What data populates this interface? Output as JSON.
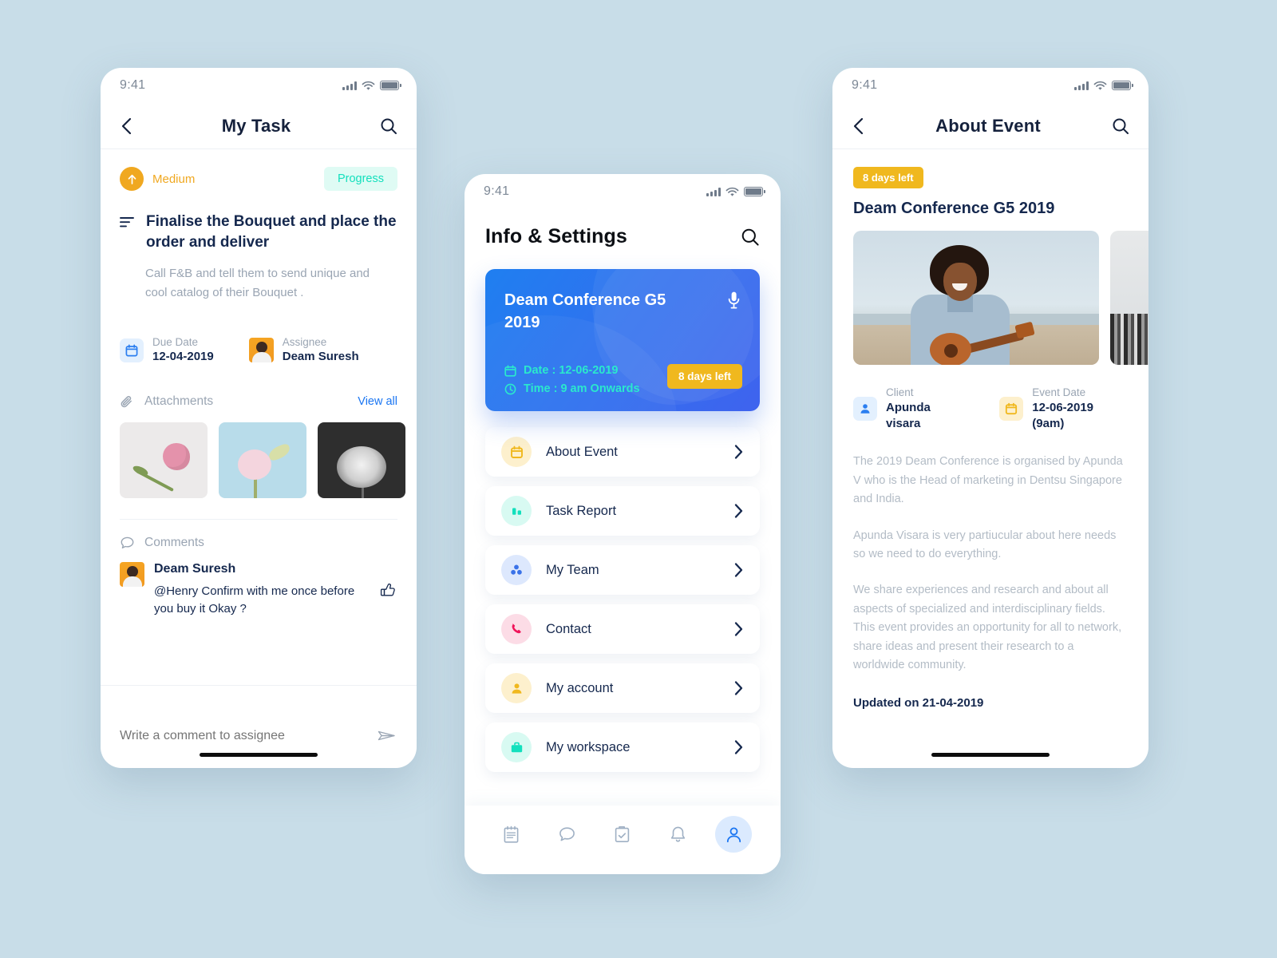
{
  "statusbar": {
    "time": "9:41"
  },
  "task_screen": {
    "nav": {
      "title": "My Task",
      "back_icon": "chevron-left-icon",
      "search_icon": "search-icon"
    },
    "priority": {
      "label": "Medium",
      "icon": "arrow-up-icon",
      "color": "#f0a820"
    },
    "status": {
      "label": "Progress",
      "color": "#13e0bd",
      "bg": "#dffbf4"
    },
    "title": "Finalise the Bouquet and place the order and deliver",
    "description": "Call F&B and tell them to send unique and cool catalog of their Bouquet .",
    "due_date": {
      "label": "Due Date",
      "value": "12-04-2019"
    },
    "assignee": {
      "label": "Assignee",
      "value": "Deam Suresh"
    },
    "attachments": {
      "title": "Attachments",
      "view_all": "View all"
    },
    "comments": {
      "title": "Comments",
      "items": [
        {
          "author": "Deam Suresh",
          "text": "@Henry Confirm with me once before you buy it Okay ?"
        }
      ]
    },
    "composer": {
      "placeholder": "Write a comment to assignee",
      "send_icon": "send-icon"
    }
  },
  "settings_screen": {
    "title": "Info & Settings",
    "search_icon": "search-icon",
    "event_card": {
      "title": "Deam Conference G5 2019",
      "date": "Date : 12-06-2019",
      "time": "Time : 9 am Onwards",
      "days_left": "8 days left",
      "mic_icon": "microphone-icon",
      "accent": "#2ae9cd",
      "chip_color": "#f0b81e"
    },
    "menu": [
      {
        "label": "About Event",
        "icon": "calendar-icon",
        "icon_color": "#f0b81e",
        "icon_bg": "#fdf0cd"
      },
      {
        "label": "Task Report",
        "icon": "bar-chart-icon",
        "icon_color": "#13e0bd",
        "icon_bg": "#d8faf2"
      },
      {
        "label": "My Team",
        "icon": "group-icon",
        "icon_color": "#3a72e8",
        "icon_bg": "#dde8fd"
      },
      {
        "label": "Contact",
        "icon": "phone-icon",
        "icon_color": "#f0145a",
        "icon_bg": "#fcdce6"
      },
      {
        "label": "My account",
        "icon": "person-icon",
        "icon_color": "#f0b81e",
        "icon_bg": "#fdf0cd"
      },
      {
        "label": "My workspace",
        "icon": "briefcase-icon",
        "icon_color": "#13e0bd",
        "icon_bg": "#d8faf2"
      }
    ],
    "tabs": [
      {
        "icon": "notepad-icon",
        "active": false
      },
      {
        "icon": "chat-bubble-icon",
        "active": false
      },
      {
        "icon": "clipboard-check-icon",
        "active": false
      },
      {
        "icon": "bell-icon",
        "active": false
      },
      {
        "icon": "profile-icon",
        "active": true
      }
    ]
  },
  "about_screen": {
    "nav": {
      "title": "About Event",
      "back_icon": "chevron-left-icon",
      "search_icon": "search-icon"
    },
    "days_left": "8 days left",
    "title": "Deam Conference G5 2019",
    "gallery": [
      {
        "alt": "woman playing ukulele on beach"
      },
      {
        "alt": "building facade"
      }
    ],
    "client": {
      "label": "Client",
      "value": "Apunda visara"
    },
    "event_date": {
      "label": "Event Date",
      "value": "12-06-2019 (9am)"
    },
    "paragraphs": [
      "The 2019 Deam Conference is organised by Apunda V who is the Head of marketing in Dentsu Singapore and India.",
      "Apunda Visara is very partiucular about here needs so we need to do everything.",
      "We share experiences and research and about all aspects of specialized and interdisciplinary fields. This event provides an opportunity for all to network, share ideas and present their research  to a worldwide community."
    ],
    "updated": "Updated on 21-04-2019"
  }
}
